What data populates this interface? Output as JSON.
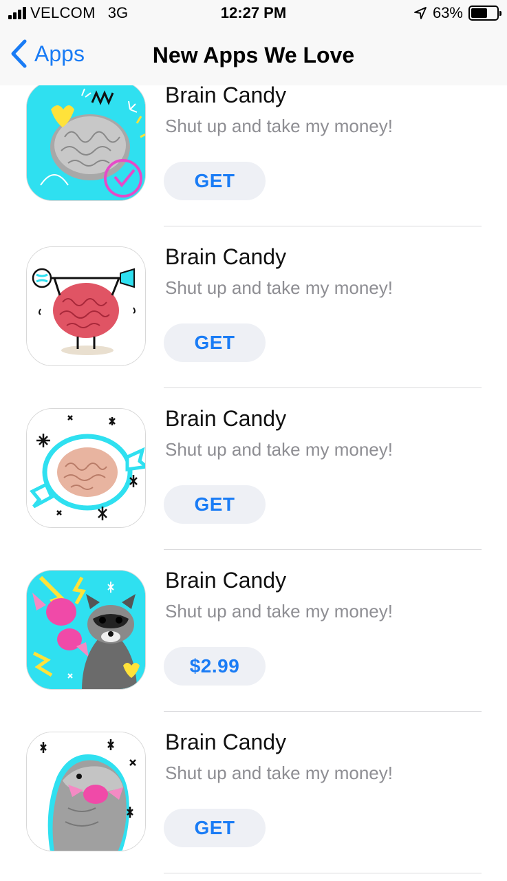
{
  "status_bar": {
    "carrier": "VELCOM",
    "network": "3G",
    "time": "12:27 PM",
    "battery": "63%",
    "battery_level": 0.63,
    "icons": [
      "signal-icon",
      "location-arrow-icon",
      "battery-icon"
    ]
  },
  "nav": {
    "back_label": "Apps",
    "title": "New Apps We Love"
  },
  "colors": {
    "accent": "#1a7cf5",
    "button_bg": "#eef0f5",
    "subtitle": "#8e8e93",
    "cyan": "#2fe0f0"
  },
  "apps": [
    {
      "name": "Brain Candy",
      "subtitle": "Shut up and take my money!",
      "button": "GET",
      "icon": "brain-grey-cyan-icon"
    },
    {
      "name": "Brain Candy",
      "subtitle": "Shut up and take my money!",
      "button": "GET",
      "icon": "brain-barbell-icon"
    },
    {
      "name": "Brain Candy",
      "subtitle": "Shut up and take my money!",
      "button": "GET",
      "icon": "brain-candy-wrapper-icon"
    },
    {
      "name": "Brain Candy",
      "subtitle": "Shut up and take my money!",
      "button": "$2.99",
      "icon": "raccoon-candy-icon"
    },
    {
      "name": "Brain Candy",
      "subtitle": "Shut up and take my money!",
      "button": "GET",
      "icon": "dinosaur-candy-icon"
    }
  ]
}
